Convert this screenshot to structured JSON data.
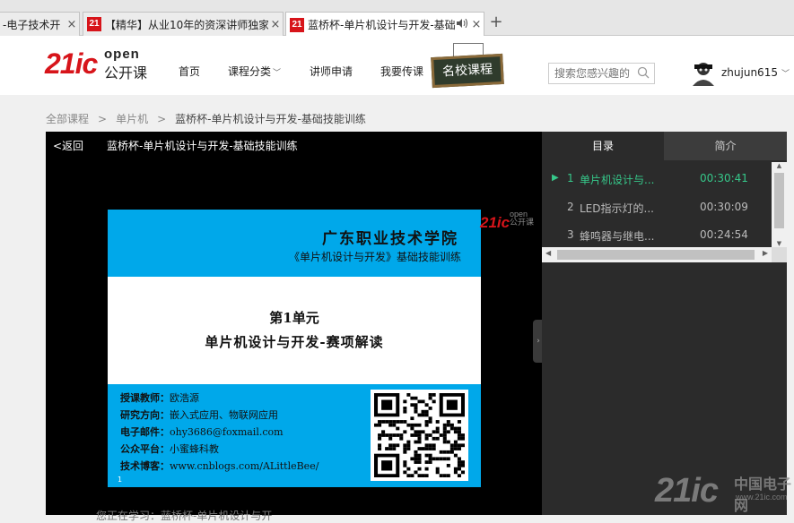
{
  "browser": {
    "tabs": [
      {
        "title": "-电子技术开",
        "favicon": ""
      },
      {
        "title": "【精华】从业10年的资深讲师独家",
        "favicon": "21"
      },
      {
        "title": "蓝桥杯-单片机设计与开发-基础",
        "favicon": "21"
      }
    ],
    "close_glyph": "×",
    "new_tab_glyph": "+"
  },
  "header": {
    "logo_main": "21ic",
    "logo_open": "open",
    "logo_sub": "公开课",
    "nav": {
      "home": "首页",
      "categories": "课程分类",
      "teacher_apply": "讲师申请",
      "teach": "我要传课",
      "famous": "名校课程"
    },
    "search_placeholder": "搜索您感兴趣的",
    "username": "zhujun615"
  },
  "breadcrumb": {
    "all": "全部课程",
    "sep": ">",
    "category": "单片机",
    "current": "蓝桥杯-单片机设计与开发-基础技能训练"
  },
  "player": {
    "back": "<返回",
    "title": "蓝桥杯-单片机设计与开发-基础技能训练",
    "watermark_main": "21ic",
    "watermark_open": "open",
    "watermark_sub": "公开课",
    "slide": {
      "school": "广东职业技术学院",
      "course": "《单片机设计与开发》基础技能训练",
      "unit": "第1单元",
      "unit_title": "单片机设计与开发-赛项解读",
      "info": [
        {
          "label": "授课教师：",
          "value": "欧浩源"
        },
        {
          "label": "研究方向：",
          "value": "嵌入式应用、物联网应用"
        },
        {
          "label": "电子邮件：",
          "value": "ohy3686@foxmail.com"
        },
        {
          "label": "公众平台：",
          "value": "小蜜蜂科教"
        },
        {
          "label": "技术博客：",
          "value": "www.cnblogs.com/ALittleBee/"
        }
      ],
      "footnote": "1"
    },
    "ticker": "您正在学习：蓝桥杯-单片机设计与开"
  },
  "sidebar": {
    "tabs": {
      "catalog": "目录",
      "intro": "简介"
    },
    "lessons": [
      {
        "num": "1",
        "name": "单片机设计与...",
        "duration": "00:30:41",
        "current": true
      },
      {
        "num": "2",
        "name": "LED指示灯的...",
        "duration": "00:30:09",
        "current": false
      },
      {
        "num": "3",
        "name": "蜂鸣器与继电...",
        "duration": "00:24:54",
        "current": false
      }
    ]
  },
  "watermark": {
    "main": "21ic",
    "cn": "中国电子网",
    "url": "www.21ic.com"
  },
  "colors": {
    "brand_red": "#d7141a",
    "accent_green": "#36c88a",
    "slide_blue": "#00a8ea"
  }
}
